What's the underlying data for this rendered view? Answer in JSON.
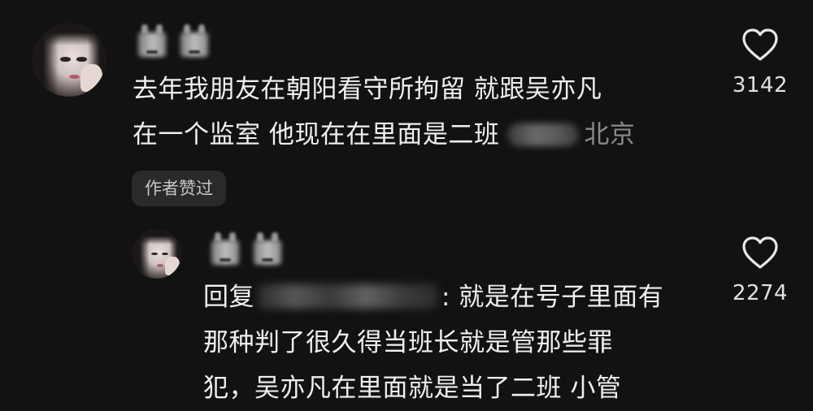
{
  "comments": [
    {
      "text_line1": "去年我朋友在朝阳看守所拘留 就跟吴亦凡",
      "text_line2": "在一个监室 他现在在里面是二班",
      "location": "北京",
      "badge": "作者赞过",
      "like_count": "3142",
      "like_icon": "heart-outline-icon"
    },
    {
      "reply_prefix": "回复",
      "text_line1_suffix": ": 就是在号子里面有",
      "text_line2": "那种判了很久得当班长就是管那些罪",
      "text_line3": "犯，吴亦凡在里面就是当了二班 小管",
      "like_count": "2274",
      "like_icon": "heart-outline-icon"
    }
  ],
  "colors": {
    "background": "#121212",
    "text": "#f0f0f0",
    "muted": "#8a8a8a",
    "badge_bg": "#2a2a2a"
  }
}
